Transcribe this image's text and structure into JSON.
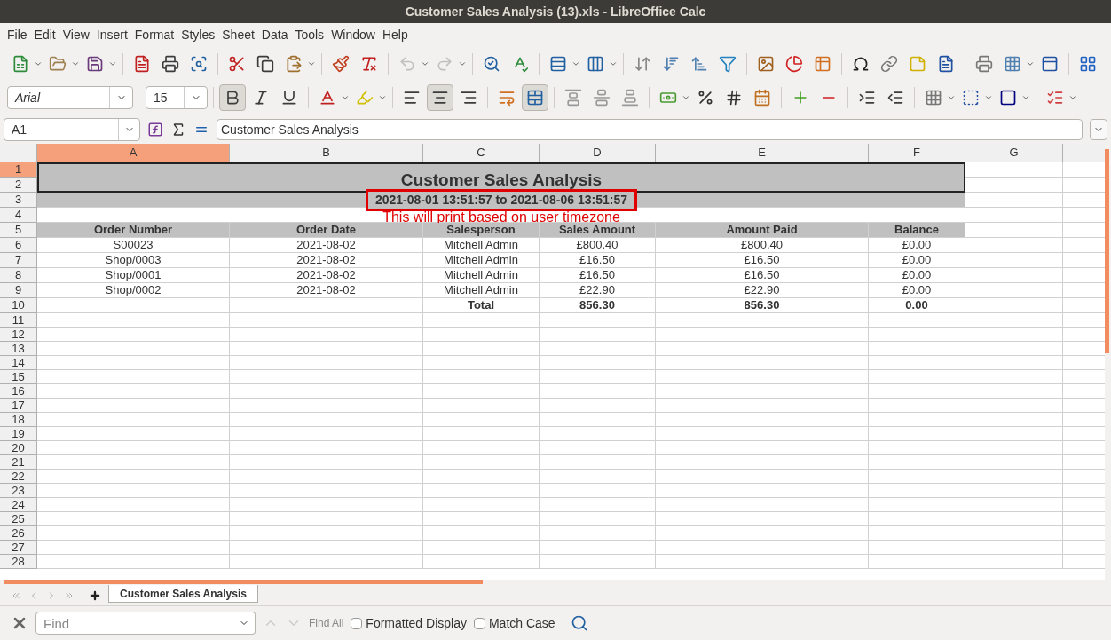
{
  "window": {
    "title": "Customer Sales Analysis (13).xls - LibreOffice Calc"
  },
  "menu": [
    "File",
    "Edit",
    "View",
    "Insert",
    "Format",
    "Styles",
    "Sheet",
    "Data",
    "Tools",
    "Window",
    "Help"
  ],
  "font": {
    "name": "Arial",
    "size": "15"
  },
  "character": {
    "bold": true,
    "italic": false,
    "underline": false
  },
  "alignment": [
    {
      "kind": "left",
      "selected": false
    },
    {
      "kind": "center",
      "selected": true
    },
    {
      "kind": "right",
      "selected": false
    }
  ],
  "wrap_text": false,
  "merge_cells": true,
  "name_box": "A1",
  "formula": "Customer Sales Analysis",
  "columns": [
    {
      "label": "A",
      "selected": true
    },
    {
      "label": "B",
      "selected": false
    },
    {
      "label": "C",
      "selected": false
    },
    {
      "label": "D",
      "selected": false
    },
    {
      "label": "E",
      "selected": false
    },
    {
      "label": "F",
      "selected": false
    },
    {
      "label": "G",
      "selected": false
    }
  ],
  "row_numbers": [
    {
      "label": "1",
      "selected": true
    },
    {
      "label": "2",
      "selected": false
    },
    {
      "label": "3",
      "selected": false
    },
    {
      "label": "4",
      "selected": false
    },
    {
      "label": "5",
      "selected": false
    },
    {
      "label": "6",
      "selected": false
    },
    {
      "label": "7",
      "selected": false
    },
    {
      "label": "8",
      "selected": false
    },
    {
      "label": "9",
      "selected": false
    },
    {
      "label": "10",
      "selected": false
    },
    {
      "label": "11",
      "selected": false
    },
    {
      "label": "12",
      "selected": false
    },
    {
      "label": "13",
      "selected": false
    },
    {
      "label": "14",
      "selected": false
    },
    {
      "label": "15",
      "selected": false
    },
    {
      "label": "16",
      "selected": false
    },
    {
      "label": "17",
      "selected": false
    },
    {
      "label": "18",
      "selected": false
    },
    {
      "label": "19",
      "selected": false
    },
    {
      "label": "20",
      "selected": false
    },
    {
      "label": "21",
      "selected": false
    },
    {
      "label": "22",
      "selected": false
    },
    {
      "label": "23",
      "selected": false
    },
    {
      "label": "24",
      "selected": false
    },
    {
      "label": "25",
      "selected": false
    },
    {
      "label": "26",
      "selected": false
    },
    {
      "label": "27",
      "selected": false
    },
    {
      "label": "28",
      "selected": false
    }
  ],
  "report": {
    "title": "Customer Sales Analysis",
    "date_range": "2021-08-01 13:51:57 to 2021-08-06 13:51:57",
    "note": "This will print based on user timezone"
  },
  "table": {
    "columns": [
      "Order Number",
      "Order Date",
      "Salesperson",
      "Sales Amount",
      "Amount Paid",
      "Balance"
    ],
    "rows": [
      [
        "S00023",
        "2021-08-02",
        "Mitchell Admin",
        "£800.40",
        "£800.40",
        "£0.00"
      ],
      [
        "Shop/0003",
        "2021-08-02",
        "Mitchell Admin",
        "£16.50",
        "£16.50",
        "£0.00"
      ],
      [
        "Shop/0001",
        "2021-08-02",
        "Mitchell Admin",
        "£16.50",
        "£16.50",
        "£0.00"
      ],
      [
        "Shop/0002",
        "2021-08-02",
        "Mitchell Admin",
        "£22.90",
        "£22.90",
        "£0.00"
      ]
    ],
    "total": {
      "label": "Total",
      "sales_amount": "856.30",
      "amount_paid": "856.30",
      "balance": "0.00"
    }
  },
  "sheet_tabs": [
    {
      "label": "Customer Sales Analysis",
      "selected": true
    }
  ],
  "find": {
    "placeholder": "Find",
    "find_all": "Find All",
    "options": [
      {
        "label": "Formatted Display",
        "checked": false
      },
      {
        "label": "Match Case",
        "checked": false
      }
    ]
  }
}
